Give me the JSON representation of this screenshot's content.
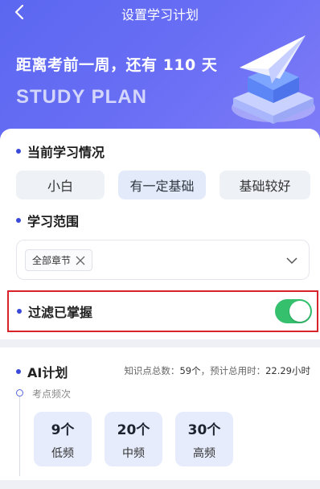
{
  "nav": {
    "title": "设置学习计划"
  },
  "hero": {
    "headline": "距离考前一周，还有 110 天",
    "tagline": "STUDY PLAN"
  },
  "current": {
    "title": "当前学习情况",
    "levels": [
      {
        "label": "小白",
        "selected": false
      },
      {
        "label": "有一定基础",
        "selected": true
      },
      {
        "label": "基础较好",
        "selected": false
      }
    ]
  },
  "scope": {
    "title": "学习范围",
    "tag": "全部章节"
  },
  "filter": {
    "title": "过滤已掌握",
    "on": true
  },
  "ai": {
    "title": "AI计划",
    "stats_prefix": "知识点总数：",
    "count": "59个",
    "stats_mid": "，预计总用时：",
    "hours": "22.29小时",
    "freq_label": "考点频次",
    "freqs": [
      {
        "count": "9个",
        "label": "低频"
      },
      {
        "count": "20个",
        "label": "中频"
      },
      {
        "count": "30个",
        "label": "高频"
      }
    ]
  },
  "colors": {
    "brand": "#5b67f0",
    "toggle_on": "#34c06d",
    "highlight_border": "#d9232b"
  }
}
